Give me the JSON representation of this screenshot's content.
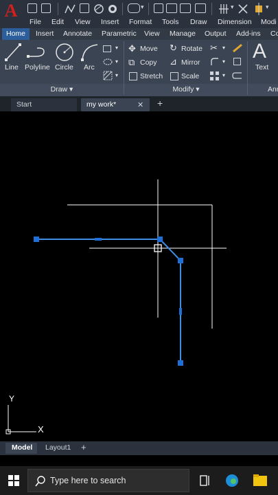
{
  "quick_access": {
    "logo_letter": "A",
    "workspace_dropdown": "▾"
  },
  "menu": {
    "items": [
      "File",
      "Edit",
      "View",
      "Insert",
      "Format",
      "Tools",
      "Draw",
      "Dimension",
      "Modi"
    ]
  },
  "ribbon_tabs": [
    "Home",
    "Insert",
    "Annotate",
    "Parametric",
    "View",
    "Manage",
    "Output",
    "Add-ins",
    "Co"
  ],
  "draw_panel": {
    "title": "Draw ▾",
    "tools": [
      "Line",
      "Polyline",
      "Circle",
      "Arc"
    ]
  },
  "modify_panel": {
    "title": "Modify ▾",
    "rows": [
      [
        "Move",
        "Rotate"
      ],
      [
        "Copy",
        "Mirror"
      ],
      [
        "Stretch",
        "Scale"
      ]
    ]
  },
  "annotation_panel": {
    "tool": "Text",
    "title_fragment": "Ann"
  },
  "file_tabs": {
    "start": "Start",
    "active": "my work*",
    "close": "✕",
    "add": "+"
  },
  "ucs": {
    "y_label": "Y",
    "x_label": "X"
  },
  "layout_tabs": {
    "model": "Model",
    "layout1": "Layout1",
    "add": "+"
  },
  "taskbar": {
    "search_placeholder": "Type here to search"
  },
  "colors": {
    "accent": "#2b5e9b",
    "grip": "#1f6fd6",
    "polyline": "#3d8fe6",
    "crosshair": "#ffffff",
    "logo": "#d21f1f"
  }
}
